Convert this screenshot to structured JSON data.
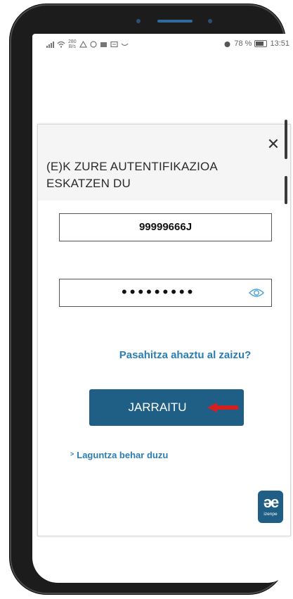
{
  "status_bar": {
    "network_speed_top": "280",
    "network_speed_bottom": "B/s",
    "battery_percent": "78 %",
    "battery_level": 0.78,
    "time": "13:51",
    "icons": [
      "signal-icon",
      "wifi-icon",
      "warning-icon",
      "whatsapp-icon",
      "app-icon",
      "message-icon",
      "smile-icon",
      "alarm-icon",
      "battery-icon"
    ]
  },
  "modal": {
    "title": "(E)K ZURE AUTENTIFIKAZIOA ESKATZEN DU",
    "close_icon": "close-icon",
    "username_value": "99999666J",
    "password_mask": "•••••••••",
    "forgot_password_label": "Pasahitza ahaztu al zaizu?",
    "continue_label": "JARRAITU",
    "help_label": "Laguntza behar duzu",
    "help_chevron": ">",
    "logo": {
      "mark": "әe",
      "text": "izenpe"
    }
  },
  "colors": {
    "primary": "#1f5f86",
    "link": "#2a7db5",
    "arrow": "#d62020",
    "header_bg": "#f5f5f5"
  }
}
